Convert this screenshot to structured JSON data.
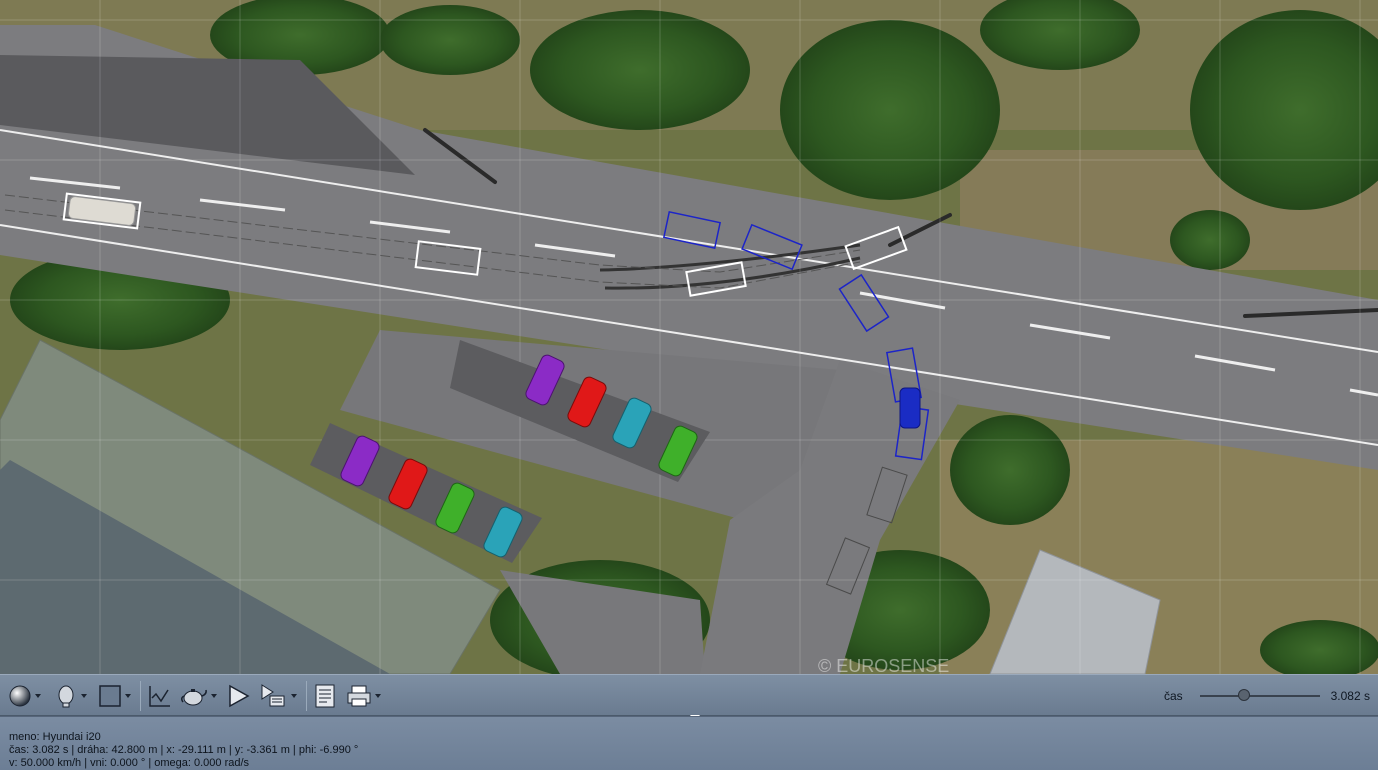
{
  "map": {
    "watermark": "© EUROSENSE"
  },
  "toolbar": {
    "render_mode_icon": "sphere-icon",
    "view_icon": "head-icon",
    "frame_icon": "square-icon",
    "graph_icon": "graph-icon",
    "teapot_icon": "teapot-icon",
    "play_icon": "play-icon",
    "step_icon": "step-play-icon",
    "report_icon": "document-icon",
    "print_icon": "printer-icon",
    "time_label": "čas",
    "time_value": "3.082 s",
    "time_progress": 0.37
  },
  "info": {
    "line1": "meno: Hyundai i20",
    "line2": "čas: 3.082 s | dráha: 42.800 m | x: -29.111 m | y: -3.361 m | phi: -6.990 °",
    "line3": "v: 50.000 km/h | vni: 0.000 ° | omega: 0.000 rad/s"
  },
  "colors": {
    "panel": "#6c7e95",
    "trajectory_white": "#ffffff",
    "trajectory_blue": "#1c24c8",
    "road": "#7c7c7f"
  }
}
